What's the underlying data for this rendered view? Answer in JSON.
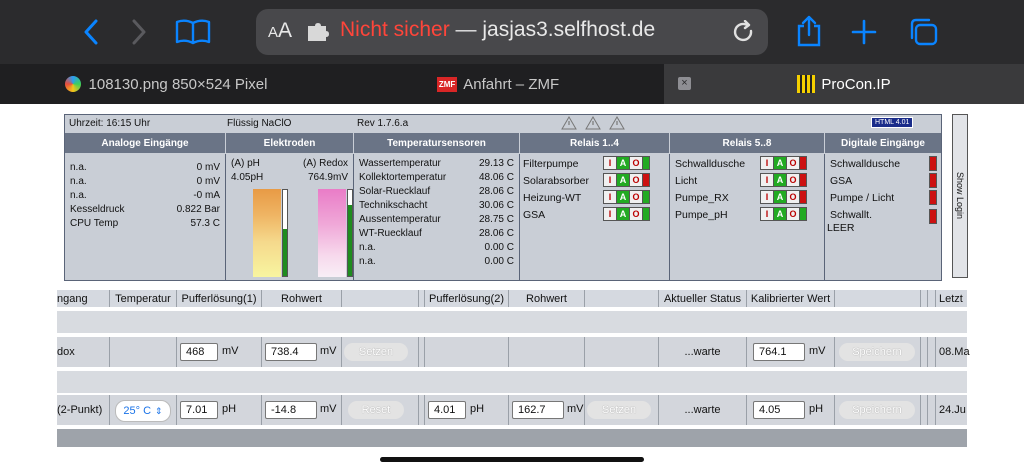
{
  "browser": {
    "url_prefix": "AA",
    "url_warning": "Nicht sicher",
    "url_separator": " — ",
    "url_host": "jasjas3.selfhost.de",
    "tabs": [
      {
        "label": "108130.png 850×524 Pixel",
        "icon": "safari-icon"
      },
      {
        "label": "Anfahrt – ZMF",
        "icon": "zmf-icon",
        "icon_text": "ZMF"
      },
      {
        "label": "ProCon.IP",
        "icon": "procon-icon",
        "active": true
      }
    ]
  },
  "panel": {
    "time": "Uhrzeit: 16:15 Uhr",
    "chlorine": "Flüssig NaClO",
    "rev": "Rev 1.7.6.a",
    "badge": "HTML 4.01",
    "headers": {
      "analog": "Analoge Eingänge",
      "electrodes": "Elektroden",
      "temps": "Temperatursensoren",
      "relays1": "Relais 1..4",
      "relays2": "Relais 5..8",
      "digital": "Digitale Eingänge"
    },
    "analog": [
      {
        "label": "n.a.",
        "value": "0 mV"
      },
      {
        "label": "n.a.",
        "value": "0 mV"
      },
      {
        "label": "n.a.",
        "value": "-0 mA"
      },
      {
        "label": "Kesseldruck",
        "value": "0.822 Bar"
      },
      {
        "label": "CPU Temp",
        "value": "57.3 C"
      }
    ],
    "electrodes": {
      "ph_label": "(A) pH",
      "ph_value": "4.05pH",
      "redox_label": "(A) Redox",
      "redox_value": "764.9mV",
      "ph_level": 0.55,
      "redox_level": 0.82
    },
    "temps": [
      {
        "label": "Wassertemperatur",
        "value": "29.13 C"
      },
      {
        "label": "Kollektortemperatur",
        "value": "48.06 C"
      },
      {
        "label": "Solar-Ruecklauf",
        "value": "28.06 C"
      },
      {
        "label": "Technikschacht",
        "value": "30.06 C"
      },
      {
        "label": "Aussentemperatur",
        "value": "28.75 C"
      },
      {
        "label": "WT-Ruecklauf",
        "value": "28.06 C"
      },
      {
        "label": "n.a.",
        "value": "0.00 C"
      },
      {
        "label": "n.a.",
        "value": "0.00 C"
      }
    ],
    "relays1": [
      "Filterpumpe",
      "Solarabsorber",
      "Heizung-WT",
      "GSA"
    ],
    "relays2": [
      "Schwalldusche",
      "Licht",
      "Pumpe_RX",
      "Pumpe_pH"
    ],
    "iao": {
      "i": "I",
      "a": "A",
      "o": "O"
    },
    "digital": [
      "Schwalldusche",
      "GSA",
      "Pumpe / Licht",
      "Schwallt."
    ],
    "digital_extra": "LEER",
    "show_login": "Show Login"
  },
  "table": {
    "headers": [
      "ngang",
      "Temperatur",
      "Pufferlösung(1)",
      "Rohwert",
      "",
      "Pufferlösung(2)",
      "Rohwert",
      "",
      "Aktueller Status",
      "Kalibrierter Wert",
      "",
      "",
      "",
      "Letzt"
    ],
    "rows": [
      {
        "name": "dox",
        "buffer1": "468",
        "buffer1_unit": "mV",
        "raw1": "738.4",
        "raw1_unit": "mV",
        "btn1": "Setzen",
        "status": "...warte",
        "calibrated": "764.1",
        "calibrated_unit": "mV",
        "save": "Speichern",
        "last": "08.Ma"
      },
      {
        "name": "(2-Punkt)",
        "temp": "25° C",
        "buffer1": "7.01",
        "buffer1_unit": "pH",
        "raw1": "-14.8",
        "raw1_unit": "mV",
        "btn1": "Reset",
        "buffer2": "4.01",
        "buffer2_unit": "pH",
        "raw2": "162.7",
        "raw2_unit": "mV",
        "btn2": "Setzen",
        "status": "...warte",
        "calibrated": "4.05",
        "calibrated_unit": "pH",
        "save": "Speichern",
        "last": "24.Ju"
      }
    ]
  }
}
